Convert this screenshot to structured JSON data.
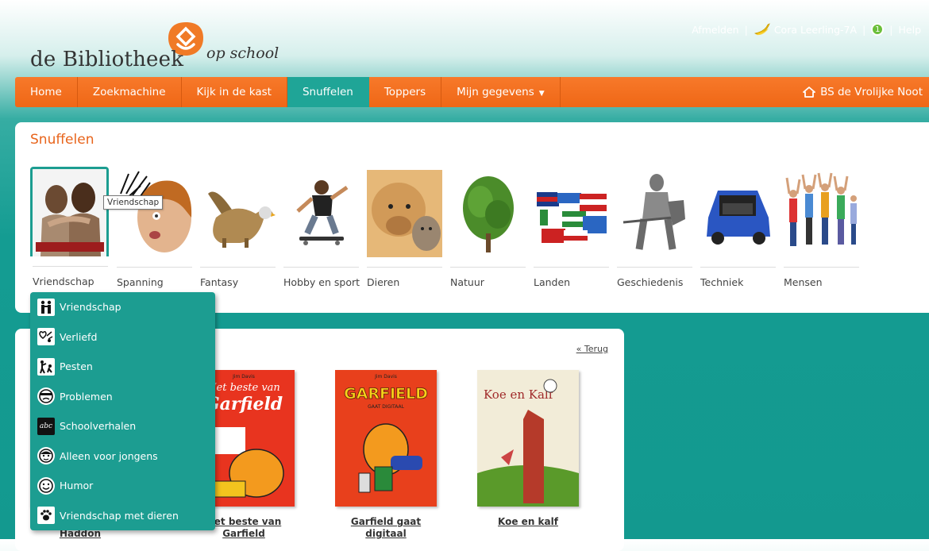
{
  "topbar": {
    "logout": "Afmelden",
    "user": "Cora Leerling-7A",
    "badge": "1",
    "help": "Help"
  },
  "logo": {
    "brand": "de Bibliotheek",
    "sub": "op school",
    "accent": "#f07a26"
  },
  "nav": {
    "items": [
      "Home",
      "Zoekmachine",
      "Kijk in de kast",
      "Snuffelen",
      "Toppers",
      "Mijn gegevens"
    ],
    "active": "Snuffelen",
    "school": "BS de Vrolijke Noot"
  },
  "snuffelen": {
    "title": "Snuffelen",
    "categories": [
      "Vriendschap",
      "Spanning",
      "Fantasy",
      "Hobby en sport",
      "Dieren",
      "Natuur",
      "Landen",
      "Geschiedenis",
      "Techniek",
      "Mensen"
    ]
  },
  "tooltip": "Vriendschap",
  "dropdown": {
    "items": [
      "Vriendschap",
      "Verliefd",
      "Pesten",
      "Problemen",
      "Schoolverhalen",
      "Alleen voor jongens",
      "Humor",
      "Vriendschap met dieren"
    ]
  },
  "results": {
    "back": "« Terug",
    "books": [
      {
        "title": "Van Charlie Haddon"
      },
      {
        "title": "Het beste van Garfield",
        "cover_top": "Het beste van",
        "cover_big": "Garfield",
        "author": "Jim Davis"
      },
      {
        "title": "Garfield gaat digitaal",
        "cover_big": "GARFIELD",
        "cover_sub": "GAAT DIGITAAL",
        "author": "Jim Davis"
      },
      {
        "title": "Koe en kalf",
        "cover_big": "Koe en Kalf"
      }
    ]
  },
  "colors": {
    "orange": "#f07020",
    "teal": "#1c9d91"
  }
}
